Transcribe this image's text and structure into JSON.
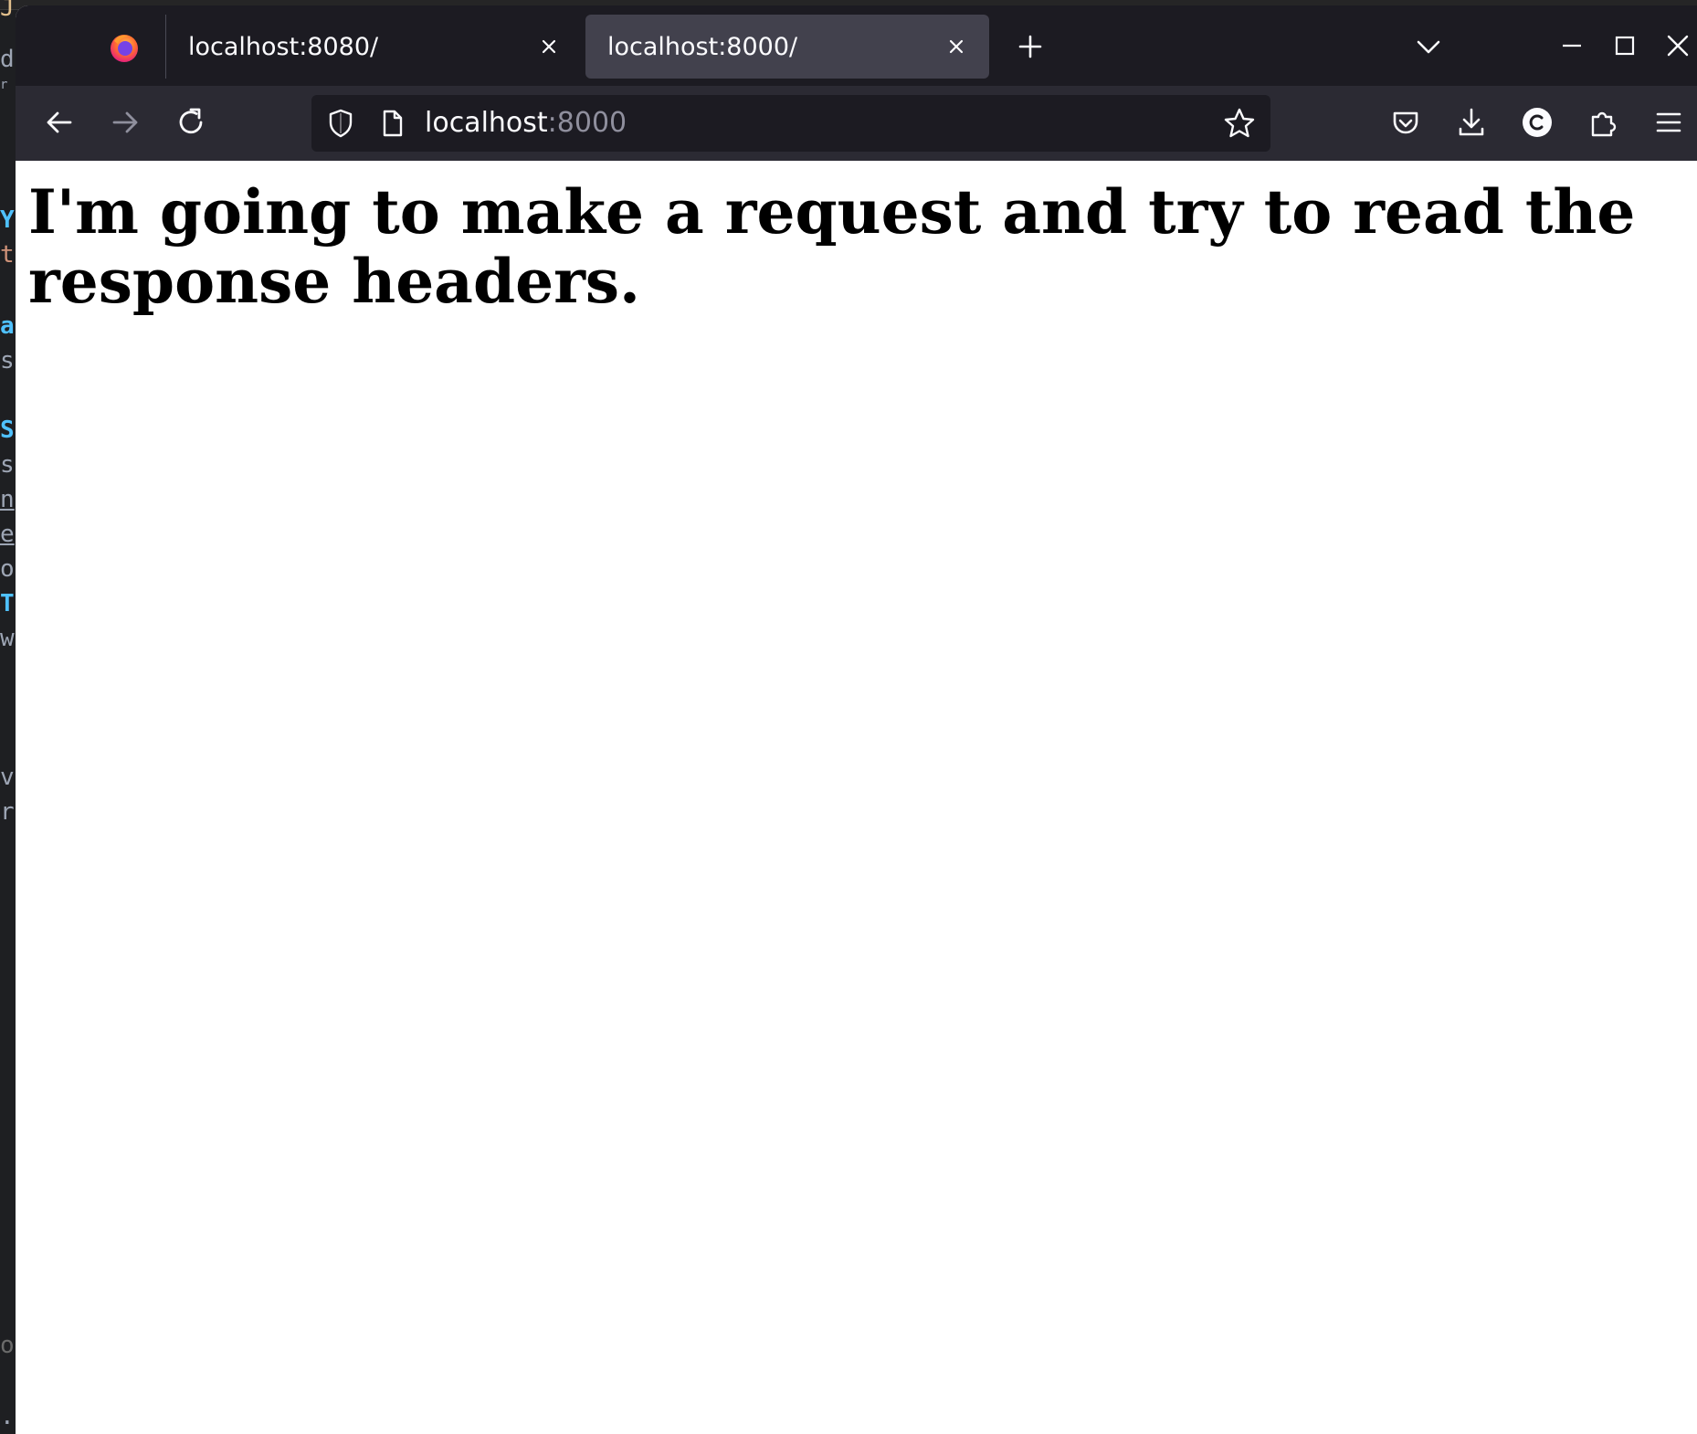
{
  "background_editor": {
    "gutter_chars": [
      "J",
      "d",
      "r",
      "Y",
      "t",
      "a",
      "s",
      "S",
      "s",
      "n",
      "e",
      "o",
      "T",
      "w",
      "v",
      "r",
      "ou",
      ".r"
    ]
  },
  "browser": {
    "tabs": [
      {
        "title": "localhost:8080/",
        "active": false
      },
      {
        "title": "localhost:8000/",
        "active": true
      }
    ],
    "urlbar": {
      "host": "localhost",
      "port": ":8000"
    },
    "colors": {
      "tabbar_bg": "#1c1b22",
      "active_tab_bg": "#42414d",
      "navbar_bg": "#2b2a33",
      "urlbar_bg": "#1c1b22",
      "text": "#fbfbfe",
      "port_text": "#8f8f9d"
    }
  },
  "page": {
    "heading": "I'm going to make a request and try to read the response headers."
  }
}
